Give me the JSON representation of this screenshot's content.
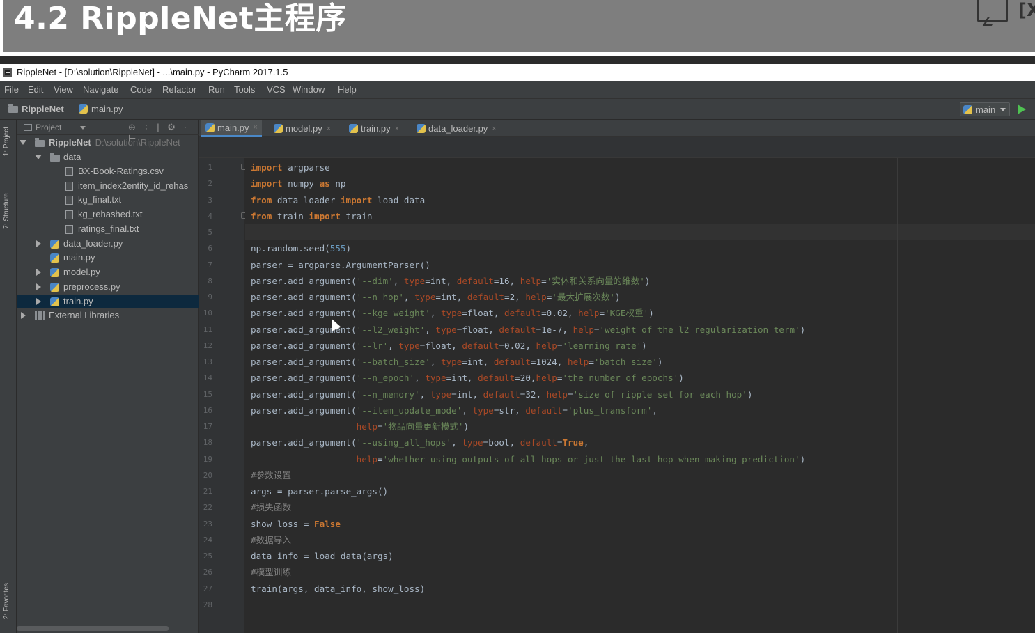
{
  "slide": {
    "title": "4.2 RippleNet主程序"
  },
  "window": {
    "title": "RippleNet - [D:\\solution\\RippleNet] - ...\\main.py - PyCharm 2017.1.5"
  },
  "menu": [
    "File",
    "Edit",
    "View",
    "Navigate",
    "Code",
    "Refactor",
    "Run",
    "Tools",
    "VCS",
    "Window",
    "Help"
  ],
  "navbar": {
    "project": "RippleNet",
    "file": "main.py",
    "run_config": "main"
  },
  "tool_tabs": {
    "project": "1: Project",
    "structure": "7: Structure",
    "favorites": "2: Favorites"
  },
  "project_panel": {
    "title": "Project",
    "root": {
      "label": "RippleNet",
      "path": "D:\\solution\\RippleNet"
    },
    "items": [
      {
        "label": "data"
      },
      {
        "label": "BX-Book-Ratings.csv"
      },
      {
        "label": "item_index2entity_id_rehas"
      },
      {
        "label": "kg_final.txt"
      },
      {
        "label": "kg_rehashed.txt"
      },
      {
        "label": "ratings_final.txt"
      },
      {
        "label": "data_loader.py"
      },
      {
        "label": "main.py"
      },
      {
        "label": "model.py"
      },
      {
        "label": "preprocess.py"
      },
      {
        "label": "train.py"
      },
      {
        "label": "External Libraries"
      }
    ]
  },
  "editor_tabs": [
    "main.py",
    "model.py",
    "train.py",
    "data_loader.py"
  ],
  "line_numbers": [
    "1",
    "2",
    "3",
    "4",
    "5",
    "6",
    "7",
    "8",
    "9",
    "10",
    "11",
    "12",
    "13",
    "14",
    "15",
    "16",
    "17",
    "18",
    "19",
    "20",
    "21",
    "22",
    "23",
    "24",
    "25",
    "26",
    "27",
    "28"
  ],
  "code": [
    [
      {
        "t": "import",
        "c": "kw"
      },
      {
        "t": " argparse"
      }
    ],
    [
      {
        "t": "import",
        "c": "kw"
      },
      {
        "t": " numpy "
      },
      {
        "t": "as",
        "c": "kw"
      },
      {
        "t": " np"
      }
    ],
    [
      {
        "t": "from",
        "c": "kw"
      },
      {
        "t": " data_loader "
      },
      {
        "t": "import",
        "c": "kw"
      },
      {
        "t": " load_data"
      }
    ],
    [
      {
        "t": "from",
        "c": "kw"
      },
      {
        "t": " train "
      },
      {
        "t": "import",
        "c": "kw"
      },
      {
        "t": " train"
      }
    ],
    [],
    [
      {
        "t": "np.random.seed("
      },
      {
        "t": "555",
        "c": "num"
      },
      {
        "t": ")"
      }
    ],
    [
      {
        "t": "parser = argparse.ArgumentParser()"
      }
    ],
    [
      {
        "t": "parser.add_argument("
      },
      {
        "t": "'--dim'",
        "c": "str"
      },
      {
        "t": ", "
      },
      {
        "t": "type",
        "c": "param"
      },
      {
        "t": "=int, "
      },
      {
        "t": "default",
        "c": "param"
      },
      {
        "t": "=16, "
      },
      {
        "t": "help",
        "c": "param"
      },
      {
        "t": "="
      },
      {
        "t": "'实体和关系向量的维数'",
        "c": "str"
      },
      {
        "t": ")"
      }
    ],
    [
      {
        "t": "parser.add_argument("
      },
      {
        "t": "'--n_hop'",
        "c": "str"
      },
      {
        "t": ", "
      },
      {
        "t": "type",
        "c": "param"
      },
      {
        "t": "=int, "
      },
      {
        "t": "default",
        "c": "param"
      },
      {
        "t": "=2, "
      },
      {
        "t": "help",
        "c": "param"
      },
      {
        "t": "="
      },
      {
        "t": "'最大扩展次数'",
        "c": "str"
      },
      {
        "t": ")"
      }
    ],
    [
      {
        "t": "parser.add_argument("
      },
      {
        "t": "'--kge_weight'",
        "c": "str"
      },
      {
        "t": ", "
      },
      {
        "t": "type",
        "c": "param"
      },
      {
        "t": "=float, "
      },
      {
        "t": "default",
        "c": "param"
      },
      {
        "t": "=0.02, "
      },
      {
        "t": "help",
        "c": "param"
      },
      {
        "t": "="
      },
      {
        "t": "'KGE权重'",
        "c": "str"
      },
      {
        "t": ")"
      }
    ],
    [
      {
        "t": "parser.add_argument("
      },
      {
        "t": "'--l2_weight'",
        "c": "str"
      },
      {
        "t": ", "
      },
      {
        "t": "type",
        "c": "param"
      },
      {
        "t": "=float, "
      },
      {
        "t": "default",
        "c": "param"
      },
      {
        "t": "=1e-7, "
      },
      {
        "t": "help",
        "c": "param"
      },
      {
        "t": "="
      },
      {
        "t": "'weight of the l2 regularization term'",
        "c": "str"
      },
      {
        "t": ")"
      }
    ],
    [
      {
        "t": "parser.add_argument("
      },
      {
        "t": "'--lr'",
        "c": "str"
      },
      {
        "t": ", "
      },
      {
        "t": "type",
        "c": "param"
      },
      {
        "t": "=float, "
      },
      {
        "t": "default",
        "c": "param"
      },
      {
        "t": "=0.02, "
      },
      {
        "t": "help",
        "c": "param"
      },
      {
        "t": "="
      },
      {
        "t": "'learning rate'",
        "c": "str"
      },
      {
        "t": ")"
      }
    ],
    [
      {
        "t": "parser.add_argument("
      },
      {
        "t": "'--batch_size'",
        "c": "str"
      },
      {
        "t": ", "
      },
      {
        "t": "type",
        "c": "param"
      },
      {
        "t": "=int, "
      },
      {
        "t": "default",
        "c": "param"
      },
      {
        "t": "=1024, "
      },
      {
        "t": "help",
        "c": "param"
      },
      {
        "t": "="
      },
      {
        "t": "'batch size'",
        "c": "str"
      },
      {
        "t": ")"
      }
    ],
    [
      {
        "t": "parser.add_argument("
      },
      {
        "t": "'--n_epoch'",
        "c": "str"
      },
      {
        "t": ", "
      },
      {
        "t": "type",
        "c": "param"
      },
      {
        "t": "=int, "
      },
      {
        "t": "default",
        "c": "param"
      },
      {
        "t": "=20,"
      },
      {
        "t": "help",
        "c": "param"
      },
      {
        "t": "="
      },
      {
        "t": "'the number of epochs'",
        "c": "str"
      },
      {
        "t": ")"
      }
    ],
    [
      {
        "t": "parser.add_argument("
      },
      {
        "t": "'--n_memory'",
        "c": "str"
      },
      {
        "t": ", "
      },
      {
        "t": "type",
        "c": "param"
      },
      {
        "t": "=int, "
      },
      {
        "t": "default",
        "c": "param"
      },
      {
        "t": "=32, "
      },
      {
        "t": "help",
        "c": "param"
      },
      {
        "t": "="
      },
      {
        "t": "'size of ripple set for each hop'",
        "c": "str"
      },
      {
        "t": ")"
      }
    ],
    [
      {
        "t": "parser.add_argument("
      },
      {
        "t": "'--item_update_mode'",
        "c": "str"
      },
      {
        "t": ", "
      },
      {
        "t": "type",
        "c": "param"
      },
      {
        "t": "=str, "
      },
      {
        "t": "default",
        "c": "param"
      },
      {
        "t": "="
      },
      {
        "t": "'plus_transform'",
        "c": "str"
      },
      {
        "t": ","
      }
    ],
    [
      {
        "t": "                    "
      },
      {
        "t": "help",
        "c": "param"
      },
      {
        "t": "="
      },
      {
        "t": "'物品向量更新模式'",
        "c": "str"
      },
      {
        "t": ")"
      }
    ],
    [
      {
        "t": "parser.add_argument("
      },
      {
        "t": "'--using_all_hops'",
        "c": "str"
      },
      {
        "t": ", "
      },
      {
        "t": "type",
        "c": "param"
      },
      {
        "t": "=bool, "
      },
      {
        "t": "default",
        "c": "param"
      },
      {
        "t": "="
      },
      {
        "t": "True",
        "c": "kw"
      },
      {
        "t": ","
      }
    ],
    [
      {
        "t": "                    "
      },
      {
        "t": "help",
        "c": "param"
      },
      {
        "t": "="
      },
      {
        "t": "'whether using outputs of all hops or just the last hop when making prediction'",
        "c": "str"
      },
      {
        "t": ")"
      }
    ],
    [
      {
        "t": "#参数设置",
        "c": "cmt"
      }
    ],
    [
      {
        "t": "args = parser.parse_args()"
      }
    ],
    [
      {
        "t": "#损失函数",
        "c": "cmt"
      }
    ],
    [
      {
        "t": "show_loss = "
      },
      {
        "t": "False",
        "c": "kw"
      }
    ],
    [
      {
        "t": "#数据导入",
        "c": "cmt"
      }
    ],
    [
      {
        "t": "data_info = load_data(args)"
      }
    ],
    [
      {
        "t": "#模型训练",
        "c": "cmt"
      }
    ],
    [
      {
        "t": "train(args, data_info, show_loss)"
      }
    ],
    []
  ]
}
